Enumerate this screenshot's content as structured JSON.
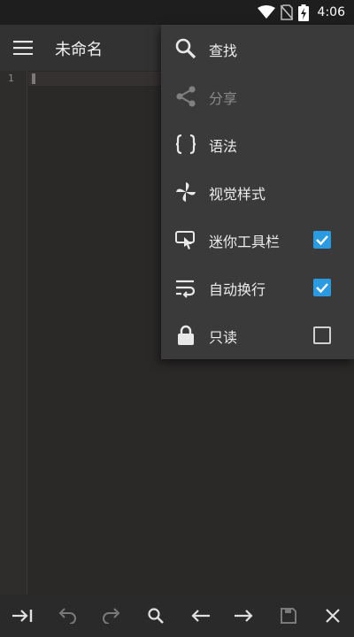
{
  "status_bar": {
    "time": "4:06",
    "icons": [
      "wifi-icon",
      "no-sim-icon",
      "battery-charging-icon"
    ]
  },
  "toolbar": {
    "title": "未命名",
    "menu_icon": "hamburger-menu-icon"
  },
  "editor": {
    "line_numbers": [
      "1"
    ]
  },
  "overflow_menu": {
    "items": [
      {
        "label": "查找",
        "icon": "search-icon",
        "enabled": true
      },
      {
        "label": "分享",
        "icon": "share-icon",
        "enabled": false
      },
      {
        "label": "语法",
        "icon": "braces-icon",
        "enabled": true
      },
      {
        "label": "视觉样式",
        "icon": "pinwheel-icon",
        "enabled": true
      },
      {
        "label": "迷你工具栏",
        "icon": "touch-toolbar-icon",
        "enabled": true,
        "checked": true
      },
      {
        "label": "自动换行",
        "icon": "wrap-text-icon",
        "enabled": true,
        "checked": true
      },
      {
        "label": "只读",
        "icon": "lock-icon",
        "enabled": true,
        "checked": false
      }
    ]
  },
  "bottom_bar": {
    "buttons": [
      "tab-indent-icon",
      "undo-icon",
      "redo-icon",
      "search-icon",
      "arrow-left-icon",
      "arrow-right-icon",
      "save-icon",
      "close-icon"
    ]
  },
  "colors": {
    "accent": "#2a9be0",
    "menu_bg": "#3a3a3a",
    "editor_bg": "#2b2928",
    "toolbar_bg": "#323232"
  }
}
